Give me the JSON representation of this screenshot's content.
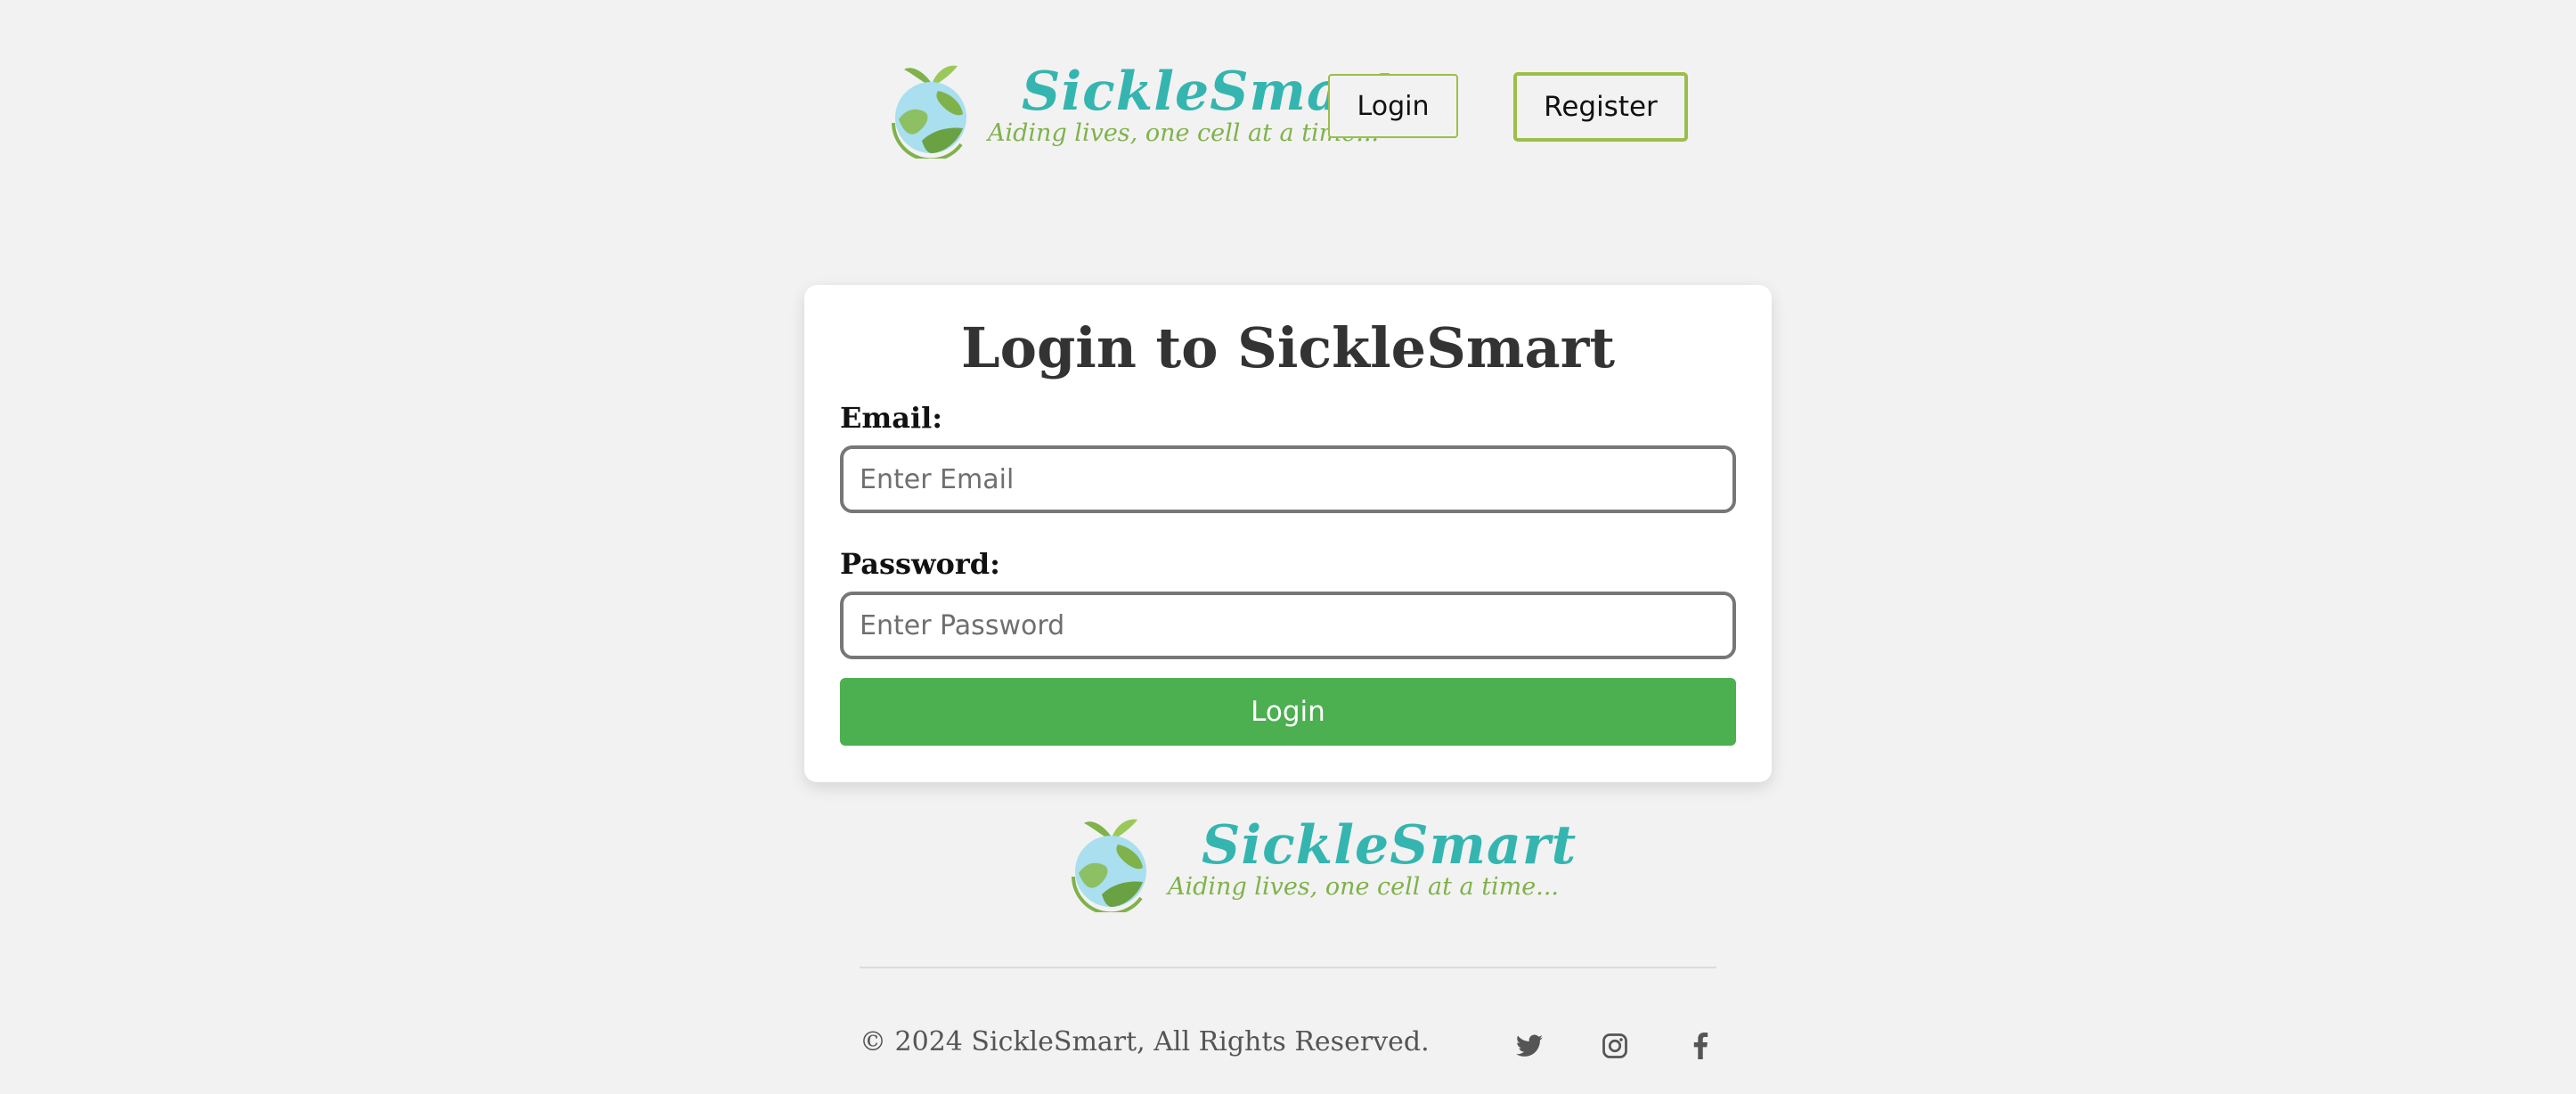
{
  "header": {
    "brand_name": "SickleSmart",
    "tagline": "Aiding lives, one cell at a time...",
    "login_label": "Login",
    "register_label": "Register"
  },
  "login_form": {
    "title": "Login to SickleSmart",
    "email_label": "Email:",
    "email_placeholder": "Enter Email",
    "email_value": "",
    "password_label": "Password:",
    "password_placeholder": "Enter Password",
    "password_value": "",
    "submit_label": "Login"
  },
  "footer": {
    "brand_name": "SickleSmart",
    "tagline": "Aiding lives, one cell at a time...",
    "copyright": "© 2024 SickleSmart, All Rights Reserved.",
    "social_icons": [
      "twitter-icon",
      "instagram-icon",
      "facebook-icon"
    ]
  },
  "colors": {
    "background": "#f2f2f2",
    "brand_teal": "#35b5b0",
    "tagline_green": "#7fb24a",
    "button_border": "#9bbf49",
    "submit_green": "#4caf50",
    "text_dark": "#333333"
  }
}
